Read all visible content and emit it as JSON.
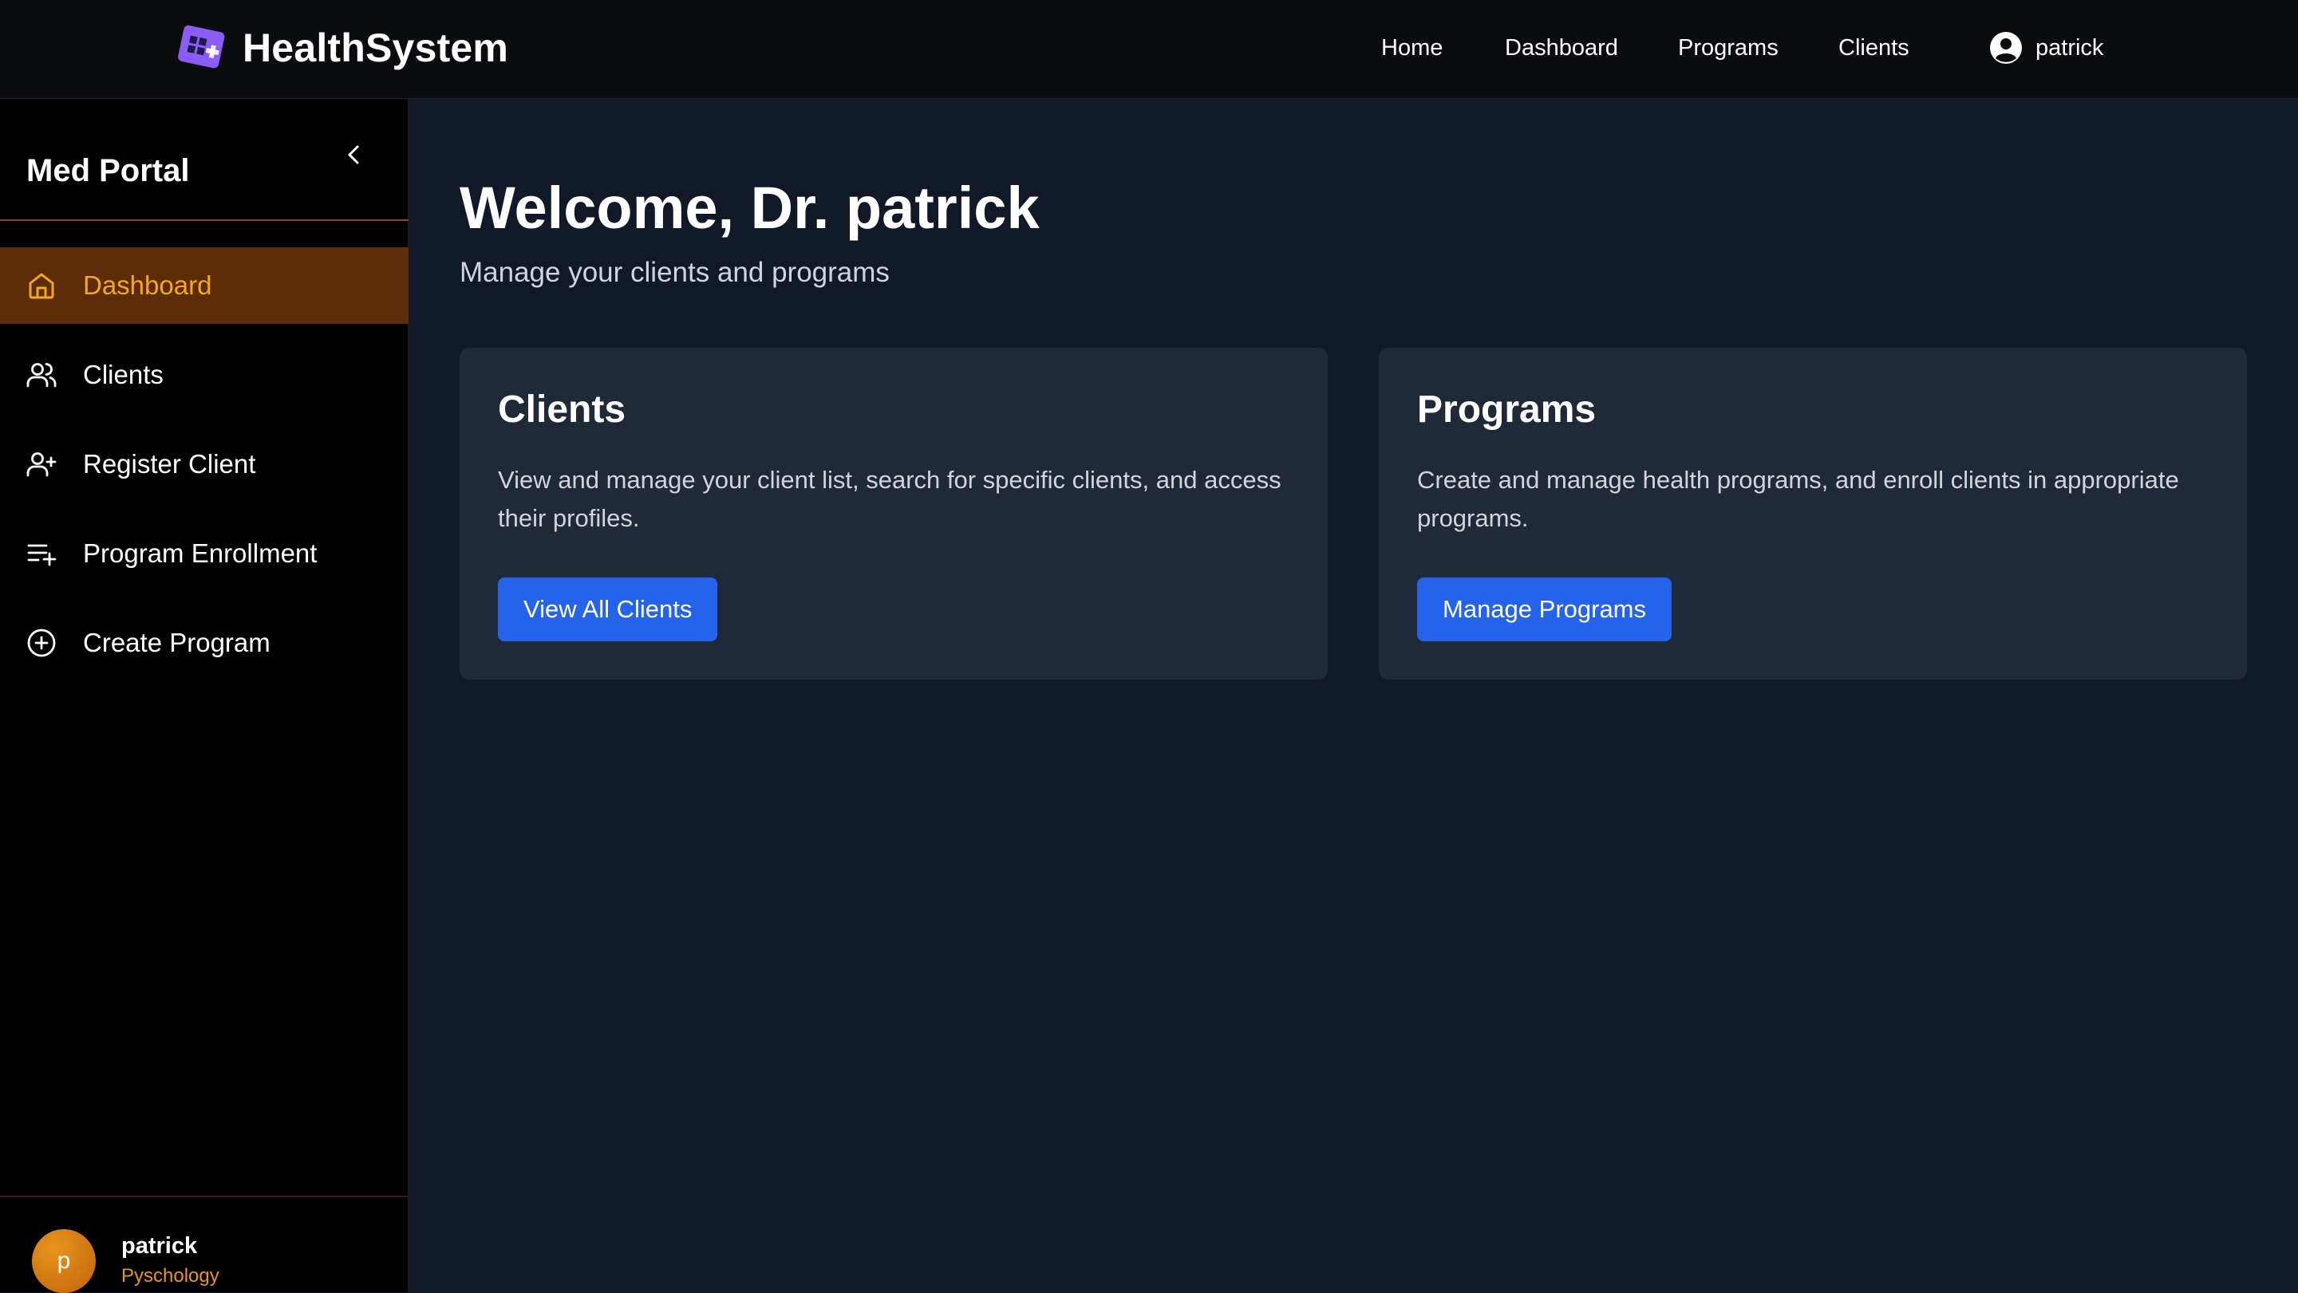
{
  "brand": {
    "name": "HealthSystem"
  },
  "topnav": {
    "home": "Home",
    "dashboard": "Dashboard",
    "programs": "Programs",
    "clients": "Clients",
    "user": "patrick"
  },
  "sidebar": {
    "title": "Med Portal",
    "items": [
      {
        "label": "Dashboard",
        "icon": "home-icon",
        "active": true
      },
      {
        "label": "Clients",
        "icon": "users-icon",
        "active": false
      },
      {
        "label": "Register Client",
        "icon": "user-plus-icon",
        "active": false
      },
      {
        "label": "Program Enrollment",
        "icon": "list-plus-icon",
        "active": false
      },
      {
        "label": "Create Program",
        "icon": "plus-circle-icon",
        "active": false
      }
    ],
    "footer": {
      "avatar_initial": "p",
      "name": "patrick",
      "department": "Pyschology"
    }
  },
  "main": {
    "welcome": "Welcome, Dr. patrick",
    "subtitle": "Manage your clients and programs",
    "cards": [
      {
        "title": "Clients",
        "description": "View and manage your client list, search for specific clients, and access their profiles.",
        "button": "View All Clients"
      },
      {
        "title": "Programs",
        "description": "Create and manage health programs, and enroll clients in appropriate programs.",
        "button": "Manage Programs"
      }
    ]
  },
  "colors": {
    "accent_orange": "#f5a623",
    "active_bg": "#5c2d08",
    "primary_button": "#2563eb",
    "logo_purple": "#8b5cf6",
    "card_bg": "#1f2937",
    "page_bg": "#111827"
  }
}
